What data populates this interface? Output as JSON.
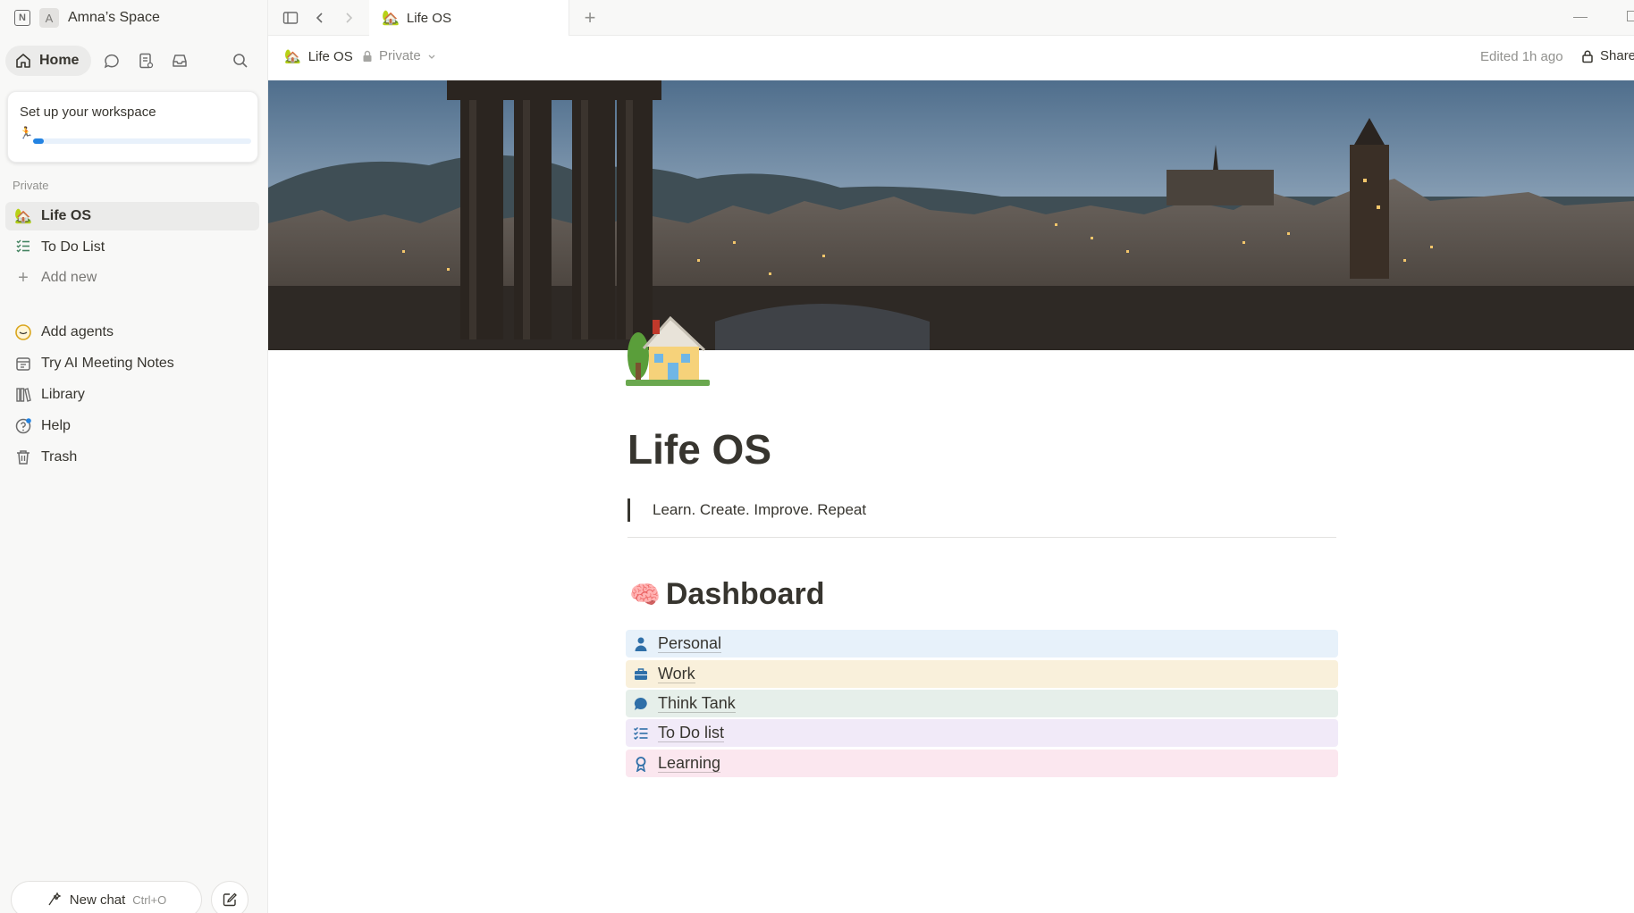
{
  "window": {
    "tab_title": "Life OS"
  },
  "workspace": {
    "avatar_letter": "A",
    "name": "Amna’s Space"
  },
  "nav": {
    "home_label": "Home"
  },
  "setup": {
    "title": "Set up your workspace",
    "progress": 0.05
  },
  "sidebar": {
    "section_label": "Private",
    "pages": [
      {
        "label": "Life OS",
        "icon": "house-icon"
      },
      {
        "label": "To Do List",
        "icon": "checklist-icon"
      },
      {
        "label": "Add new",
        "icon": "plus-icon"
      }
    ],
    "tools": [
      {
        "label": "Add agents",
        "icon": "agent-icon"
      },
      {
        "label": "Try AI Meeting Notes",
        "icon": "calendar-icon"
      },
      {
        "label": "Library",
        "icon": "library-icon"
      },
      {
        "label": "Help",
        "icon": "help-icon"
      },
      {
        "label": "Trash",
        "icon": "trash-icon"
      }
    ]
  },
  "bottom": {
    "new_chat_label": "New chat",
    "new_chat_shortcut": "Ctrl+O"
  },
  "breadcrumb": {
    "page": "Life OS",
    "privacy": "Private"
  },
  "topbar": {
    "edited": "Edited 1h ago",
    "share": "Share"
  },
  "page": {
    "title": "Life OS",
    "quote": "Learn. Create. Improve. Repeat",
    "dashboard_heading": "Dashboard",
    "dashboard_items": [
      {
        "label": "Personal",
        "icon": "person-icon",
        "bg": "#e7f1fa",
        "color": "#2f6fa8"
      },
      {
        "label": "Work",
        "icon": "briefcase-icon",
        "bg": "#f9f0db",
        "color": "#2f6fa8"
      },
      {
        "label": "Think Tank",
        "icon": "thought-bubble-icon",
        "bg": "#e6efea",
        "color": "#2f6fa8"
      },
      {
        "label": "To Do list",
        "icon": "checklist-icon",
        "bg": "#f1eaf8",
        "color": "#2f6fa8"
      },
      {
        "label": "Learning",
        "icon": "ribbon-icon",
        "bg": "#fbe7ef",
        "color": "#2f6fa8"
      }
    ]
  },
  "colors": {
    "accent": "#2383e2",
    "sidebar_bg": "#f8f8f7",
    "text": "#37352f",
    "muted": "#91918e"
  }
}
